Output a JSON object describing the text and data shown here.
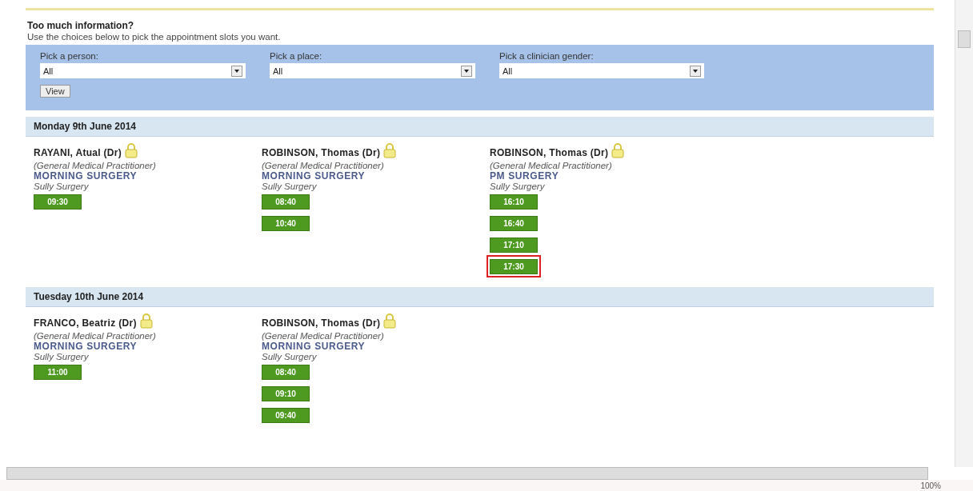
{
  "intro": {
    "title": "Too much information?",
    "text": "Use the choices below to pick the appointment slots you want."
  },
  "filters": [
    {
      "label": "Pick a person:",
      "value": "All"
    },
    {
      "label": "Pick a place:",
      "value": "All"
    },
    {
      "label": "Pick a clinician gender:",
      "value": "All"
    }
  ],
  "view_button": "View",
  "days": [
    {
      "date": "Monday 9th June 2014",
      "sessions": [
        {
          "clinician": "RAYANI, Atual (Dr)",
          "role": "(General Medical Practitioner)",
          "session": "MORNING SURGERY",
          "place": "Sully Surgery",
          "slots": [
            {
              "time": "09:30",
              "highlighted": false
            }
          ]
        },
        {
          "clinician": "ROBINSON, Thomas (Dr)",
          "role": "(General Medical Practitioner)",
          "session": "MORNING SURGERY",
          "place": "Sully Surgery",
          "slots": [
            {
              "time": "08:40",
              "highlighted": false
            },
            {
              "time": "10:40",
              "highlighted": false
            }
          ]
        },
        {
          "clinician": "ROBINSON, Thomas (Dr)",
          "role": "(General Medical Practitioner)",
          "session": "PM SURGERY",
          "place": "Sully Surgery",
          "slots": [
            {
              "time": "16:10",
              "highlighted": false
            },
            {
              "time": "16:40",
              "highlighted": false
            },
            {
              "time": "17:10",
              "highlighted": false
            },
            {
              "time": "17:30",
              "highlighted": true
            }
          ]
        }
      ]
    },
    {
      "date": "Tuesday 10th June 2014",
      "sessions": [
        {
          "clinician": "FRANCO, Beatriz (Dr)",
          "role": "(General Medical Practitioner)",
          "session": "MORNING SURGERY",
          "place": "Sully Surgery",
          "slots": [
            {
              "time": "11:00",
              "highlighted": false
            }
          ]
        },
        {
          "clinician": "ROBINSON, Thomas (Dr)",
          "role": "(General Medical Practitioner)",
          "session": "MORNING SURGERY",
          "place": "Sully Surgery",
          "slots": [
            {
              "time": "08:40",
              "highlighted": false
            },
            {
              "time": "09:10",
              "highlighted": false
            },
            {
              "time": "09:40",
              "highlighted": false
            }
          ]
        }
      ]
    }
  ],
  "status_bar": {
    "zoom": "100%"
  }
}
